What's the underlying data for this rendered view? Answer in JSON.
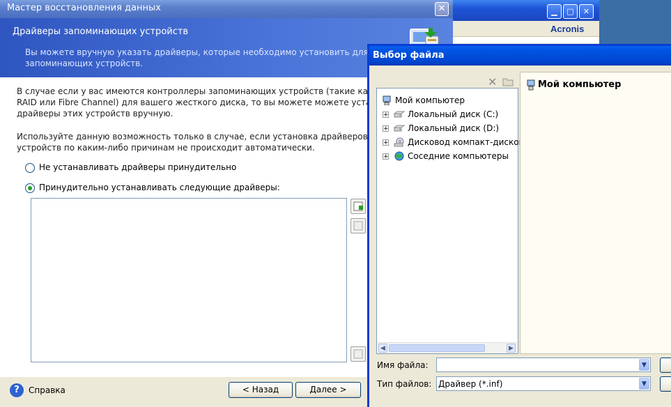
{
  "background_window": {
    "logo": "Acronis",
    "minimize_glyph": "▁",
    "maximize_glyph": "□",
    "close_glyph": "✕"
  },
  "wizard": {
    "title": "Мастер восстановления данных",
    "close_glyph": "✕",
    "header": {
      "title": "Драйверы запоминающих устройств",
      "subtitle": "Вы можете вручную указать драйверы, которые необходимо установить для запоминающих устройств."
    },
    "body": {
      "paragraph1": "В случае если у вас имеются контроллеры запоминающих устройств (такие как SCSI, RAID или Fibre Channel) для вашего жесткого диска, то вы можете можете установить драйверы этих устройств вручную.",
      "paragraph2": "Используйте данную возможность только в случае, если установка драйверов устройств по каким-либо причинам не происходит автоматически.",
      "option_no_force": "Не устанавливать драйверы принудительно",
      "option_force": "Принудительно устанавливать следующие драйверы:",
      "selected_option": "option_force"
    },
    "footer": {
      "help_glyph": "?",
      "help_label": "Справка",
      "back_label": "< Назад",
      "next_label": "Далее >"
    }
  },
  "file_dialog": {
    "title": "Выбор файла",
    "delete_glyph": "✕",
    "tree": [
      {
        "label": "Мой компьютер",
        "icon": "computer-icon",
        "expandable": false
      },
      {
        "label": "Локальный диск (C:)",
        "icon": "drive-icon",
        "expandable": true
      },
      {
        "label": "Локальный диск (D:)",
        "icon": "drive-icon",
        "expandable": true
      },
      {
        "label": "Дисковод компакт-дисков",
        "icon": "cd-drive-icon",
        "expandable": true
      },
      {
        "label": "Соседние компьютеры",
        "icon": "network-icon",
        "expandable": true
      }
    ],
    "expand_glyph": "+",
    "right_panel_title": "Мой компьютер",
    "scroll_left_glyph": "◀",
    "scroll_right_glyph": "▶",
    "combo_arrow_glyph": "▼",
    "filename_label": "Имя файла:",
    "filename_value": "",
    "filetype_label": "Тип файлов:",
    "filetype_value": "Драйвер (*.inf)"
  },
  "colors": {
    "xp_blue_title": "#0054e3",
    "wizard_header": "#2f56c0",
    "radio_dot": "#21a121"
  }
}
